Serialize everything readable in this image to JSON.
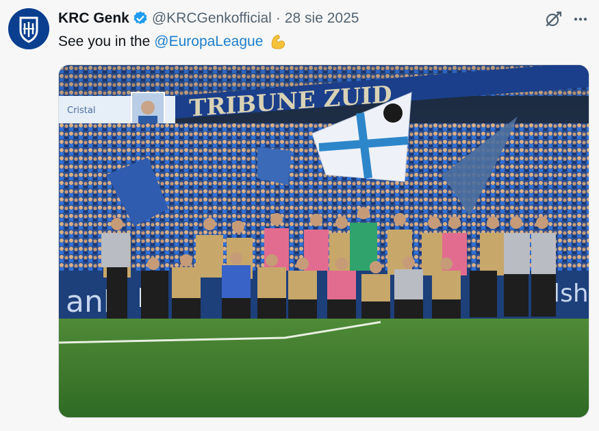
{
  "tweet": {
    "author_name": "KRC Genk",
    "handle": "@KRCGenkofficial",
    "separator": "·",
    "date": "28 sie 2025",
    "text_prefix": "See you in the",
    "mention": "@EuropaLeague",
    "emoji": "flexed-biceps-emoji"
  },
  "media": {
    "stand_banner": "TRIBUNE ZUID",
    "sponsor_left": "Cristal",
    "board_left": "anh",
    "board_right": "alsh",
    "team_colors": {
      "home": "#c7a76a",
      "keeper": "#2fa36b",
      "sub": "#e26c8f"
    }
  },
  "icons": {
    "verified": "verified-badge-icon",
    "grok": "grok-icon",
    "more": "more-icon"
  },
  "colors": {
    "verified_blue": "#1d9bf0",
    "mention_blue": "#1d7fd0",
    "club_blue": "#0a3f8f",
    "pitch_green": "#3c7a2e"
  }
}
